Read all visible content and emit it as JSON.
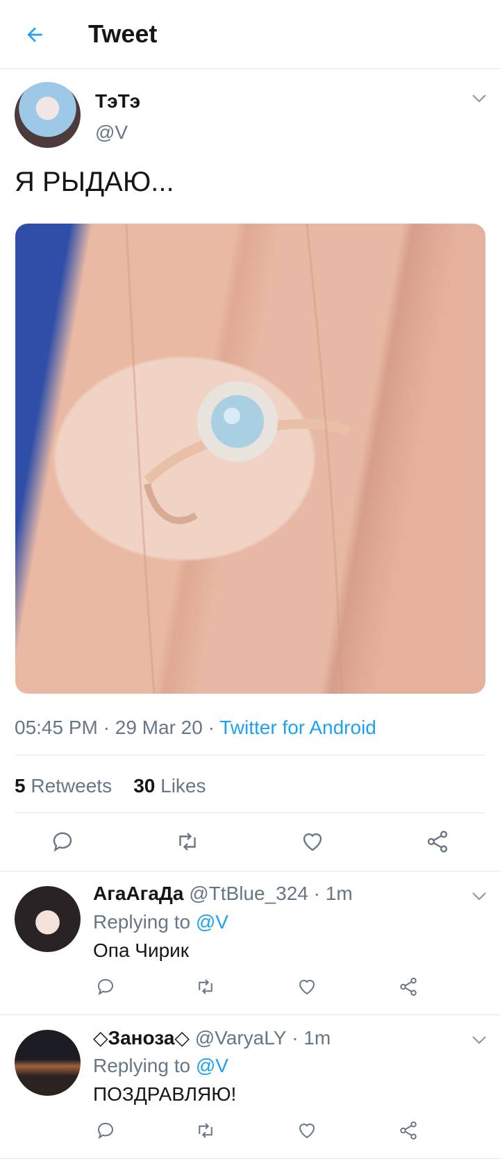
{
  "header": {
    "title": "Tweet"
  },
  "main_tweet": {
    "author_name": "ТэТэ",
    "author_handle": "@V",
    "text": "Я РЫДАЮ...",
    "time": "05:45 PM",
    "date": "29 Mar 20",
    "source": "Twitter for Android",
    "retweets_count": "5",
    "retweets_label": "Retweets",
    "likes_count": "30",
    "likes_label": "Likes"
  },
  "replies": [
    {
      "name": "АгаАгаДа",
      "handle": "@TtBlue_324",
      "time": "1m",
      "replying_prefix": "Replying to",
      "replying_to": "@V",
      "text": "Опа Чирик"
    },
    {
      "name": "◇Заноза◇",
      "handle": "@VaryaLY",
      "time": "1m",
      "replying_prefix": "Replying to",
      "replying_to": "@V",
      "text": "ПОЗДРАВЛЯЮ!"
    }
  ],
  "icons": {
    "back": "arrow-left-icon",
    "reply": "reply-icon",
    "retweet": "retweet-icon",
    "like": "heart-icon",
    "share": "share-icon",
    "caret": "chevron-down-icon"
  },
  "colors": {
    "accent": "#1da1f2",
    "secondary_text": "#657786",
    "divider": "#e1e8ed"
  }
}
